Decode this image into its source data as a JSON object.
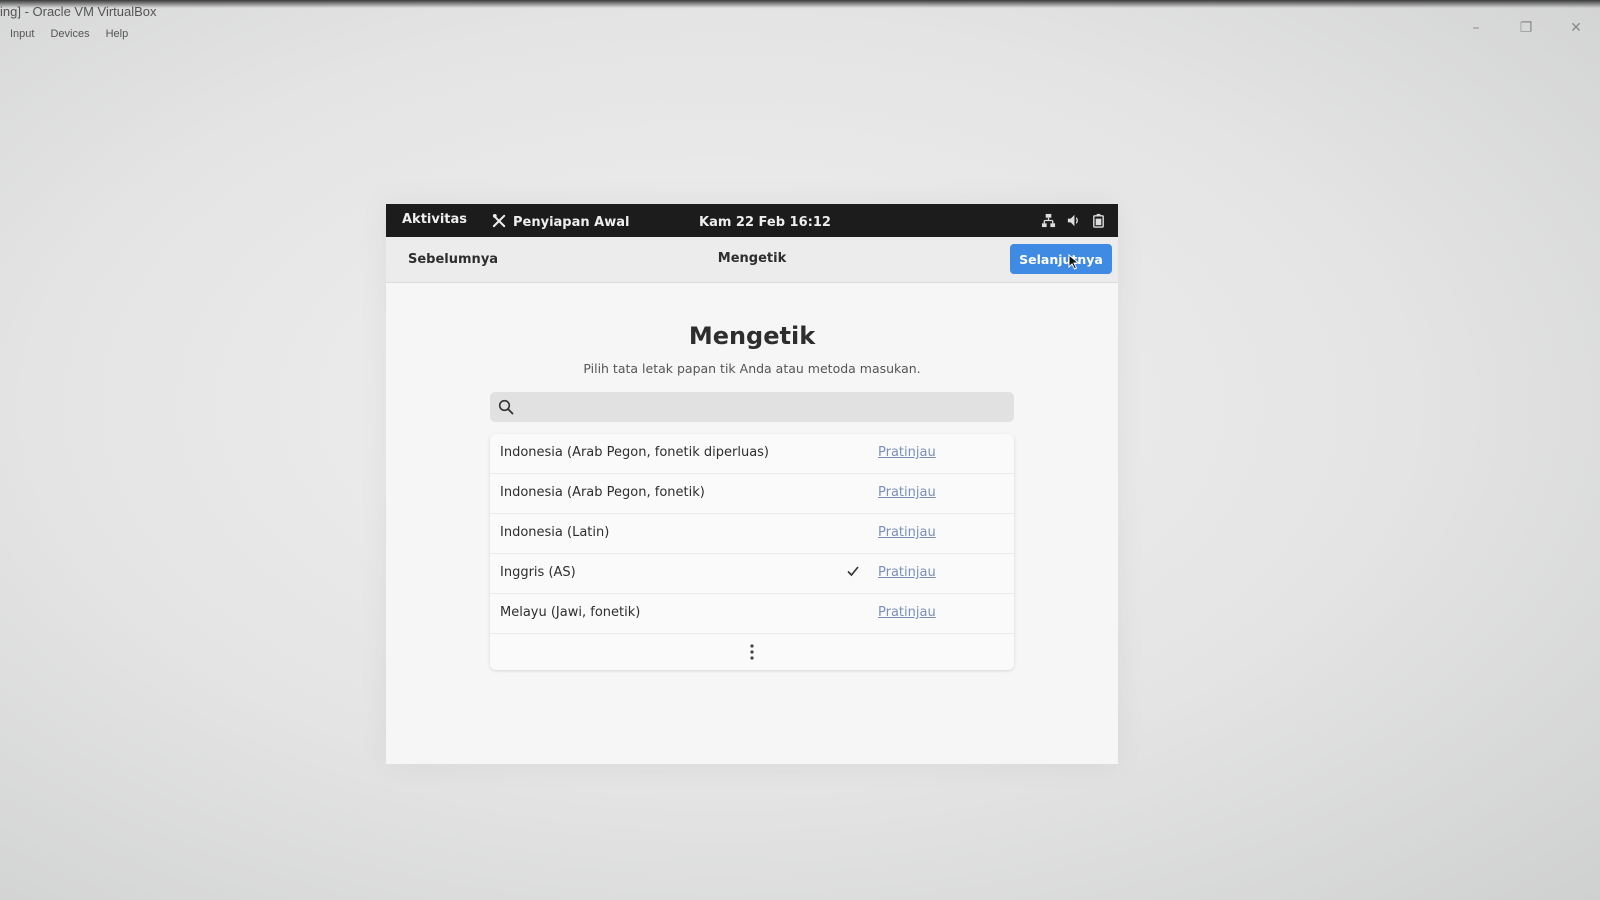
{
  "host": {
    "title": "ing] - Oracle VM VirtualBox",
    "menu": [
      "Input",
      "Devices",
      "Help"
    ],
    "controls": [
      "minimize-icon",
      "restore-icon",
      "close-icon"
    ]
  },
  "topbar": {
    "activities": "Aktivitas",
    "app_name": "Penyiapan Awal",
    "clock": "Kam 22 Feb  16:12",
    "tray_icons": [
      "network-icon",
      "volume-icon",
      "battery-icon"
    ]
  },
  "headerbar": {
    "prev_label": "Sebelumnya",
    "title": "Mengetik",
    "next_label": "Selanjutnya",
    "accent": "#3f8ae2"
  },
  "content": {
    "title": "Mengetik",
    "subtitle": "Pilih tata letak papan tik Anda atau metoda masukan.",
    "search_value": "",
    "items": [
      {
        "label": "Indonesia (Arab Pegon, fonetik diperluas)",
        "link": "Pratinjau",
        "selected": false
      },
      {
        "label": "Indonesia (Arab Pegon, fonetik)",
        "link": "Pratinjau",
        "selected": false
      },
      {
        "label": "Indonesia (Latin)",
        "link": "Pratinjau",
        "selected": false
      },
      {
        "label": "Inggris (AS)",
        "link": "Pratinjau",
        "selected": true
      },
      {
        "label": "Melayu (Jawi, fonetik)",
        "link": "Pratinjau",
        "selected": false
      }
    ],
    "more_icon": "more-vertical-icon"
  }
}
